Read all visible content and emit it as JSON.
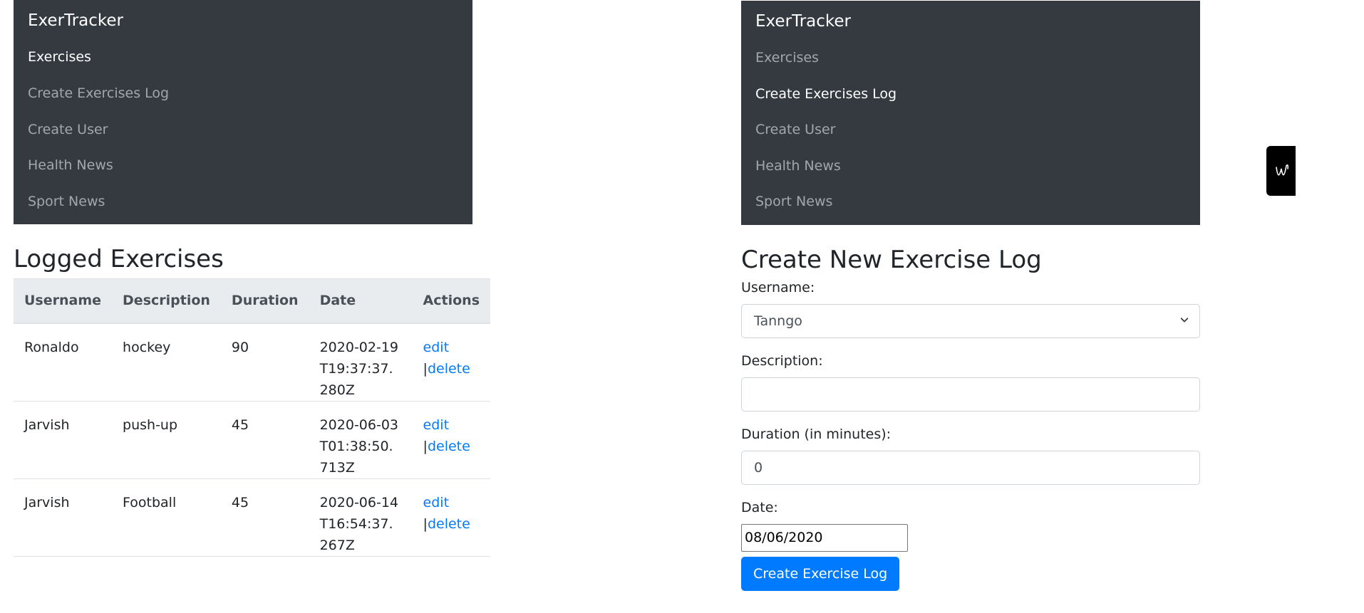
{
  "left": {
    "navbar": {
      "brand": "ExerTracker",
      "items": [
        {
          "label": "Exercises",
          "active": true
        },
        {
          "label": "Create Exercises Log",
          "active": false
        },
        {
          "label": "Create User",
          "active": false
        },
        {
          "label": "Health News",
          "active": false
        },
        {
          "label": "Sport News",
          "active": false
        }
      ]
    },
    "heading": "Logged Exercises",
    "table": {
      "headers": [
        "Username",
        "Description",
        "Duration",
        "Date",
        "Actions"
      ],
      "rows": [
        {
          "username": "Ronaldo",
          "description": "hockey",
          "duration": "90",
          "date": "2020-02-19T19:37:37.280Z"
        },
        {
          "username": "Jarvish",
          "description": "push-up",
          "duration": "45",
          "date": "2020-06-03T01:38:50.713Z"
        },
        {
          "username": "Jarvish",
          "description": "Football",
          "duration": "45",
          "date": "2020-06-14T16:54:37.267Z"
        }
      ],
      "edit_label": "edit",
      "separator": "|",
      "delete_label": "delete"
    }
  },
  "right": {
    "navbar": {
      "brand": "ExerTracker",
      "items": [
        {
          "label": "Exercises",
          "active": false
        },
        {
          "label": "Create Exercises Log",
          "active": true
        },
        {
          "label": "Create User",
          "active": false
        },
        {
          "label": "Health News",
          "active": false
        },
        {
          "label": "Sport News",
          "active": false
        }
      ]
    },
    "heading": "Create New Exercise Log",
    "form": {
      "username_label": "Username:",
      "username_value": "Tanngo",
      "description_label": "Description:",
      "description_value": "",
      "duration_label": "Duration (in minutes):",
      "duration_value": "0",
      "date_label": "Date:",
      "date_value": "08/06/2020",
      "submit_label": "Create Exercise Log"
    }
  },
  "colors": {
    "navbar_bg": "#343a40",
    "primary": "#007bff",
    "table_header_bg": "#e9ecef"
  },
  "icons": {
    "select_arrow": "chevron-down-icon",
    "floating_widget": "signature-icon"
  }
}
